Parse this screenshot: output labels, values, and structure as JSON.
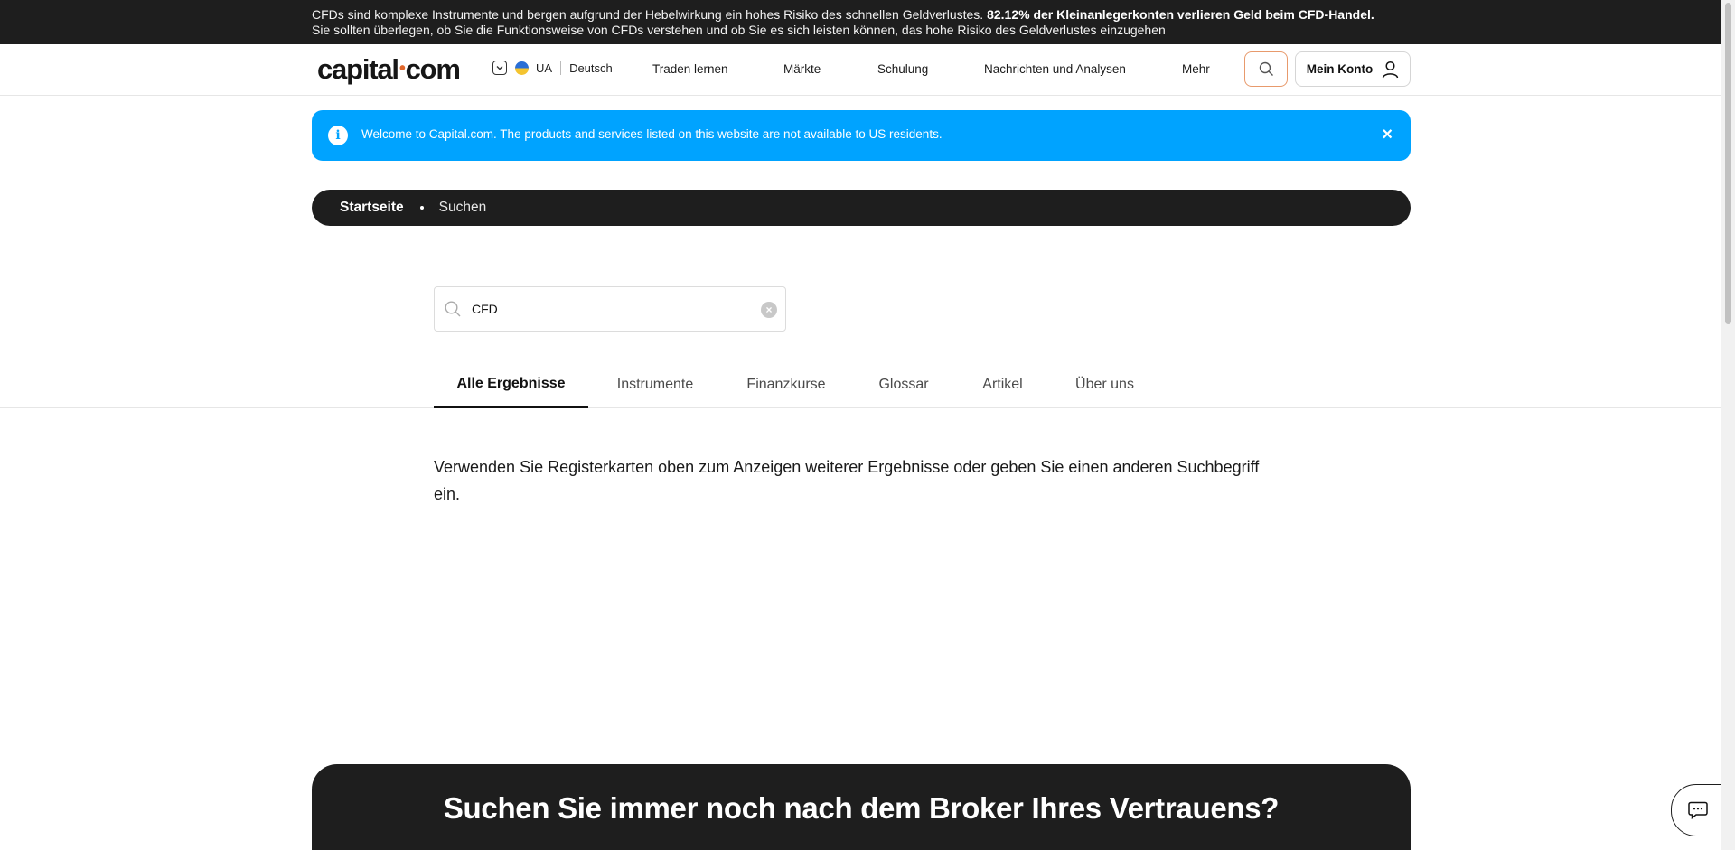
{
  "risk_warning": {
    "text_start": "CFDs sind komplexe Instrumente und bergen aufgrund der Hebelwirkung ein hohes Risiko des schnellen Geldverlustes. ",
    "text_bold": "82.12% der Kleinanlegerkonten verlieren Geld beim CFD-Handel.",
    "text_end": " Sie sollten überlegen, ob Sie die Funktionsweise von CFDs verstehen und ob Sie es sich leisten können, das hohe Risiko des Geldverlustes einzugehen"
  },
  "header": {
    "logo_left": "capital",
    "logo_dot": "•",
    "logo_right": "com",
    "country_code": "UA",
    "language": "Deutsch",
    "nav": [
      "Traden lernen",
      "Märkte",
      "Schulung",
      "Nachrichten und Analysen",
      "Mehr"
    ],
    "account_label": "Mein Konto"
  },
  "info_banner": {
    "icon": "info-icon",
    "message": "Welcome to Capital.com. The products and services listed on this website are not available to US residents.",
    "close": "×"
  },
  "breadcrumb": {
    "home": "Startseite",
    "current": "Suchen"
  },
  "search": {
    "value": "CFD",
    "clear": "×"
  },
  "tabs": [
    "Alle Ergebnisse",
    "Instrumente",
    "Finanzkurse",
    "Glossar",
    "Artikel",
    "Über uns"
  ],
  "active_tab": "Alle Ergebnisse",
  "hint_text": "Verwenden Sie Registerkarten oben zum Anzeigen weiterer Ergebnisse oder geben Sie einen anderen Suchbegriff ein.",
  "cta": {
    "title": "Suchen Sie immer noch nach dem Broker Ihres Vertrauens?"
  },
  "colors": {
    "banner_blue": "#00a3ff",
    "dark": "#1e1e1e",
    "accent_orange": "#e0662a"
  }
}
